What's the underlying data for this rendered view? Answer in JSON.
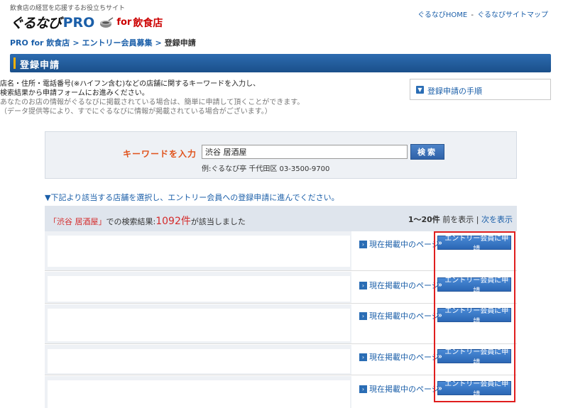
{
  "header": {
    "tagline": "飲食店の経営を応援するお役立ちサイト",
    "logo": {
      "gurunavi": "ぐるなび",
      "pro": "PRO",
      "for": "for",
      "shop": "飲食店"
    },
    "links": {
      "home": "ぐるなびHOME",
      "separator": "-",
      "sitemap": "ぐるなびサイトマップ"
    }
  },
  "breadcrumb": {
    "items": [
      "PRO for 飲食店",
      "エントリー会員募集"
    ],
    "current": "登録申請",
    "arrow": ">"
  },
  "page_title": "登録申請",
  "intro": {
    "line1": "店名・住所・電話番号(※ハイフン含む)などの店舗に関するキーワードを入力し、",
    "line2": "検索結果から申請フォームにお進みください。",
    "line3": "あなたのお店の情報がぐるなびに掲載されている場合は、簡単に申請して頂くことができます。",
    "line4": "（データ提供等により、すでにぐるなびに情報が掲載されている場合がございます。）"
  },
  "steps_link": "登録申請の手順",
  "search": {
    "label": "キーワードを入力",
    "value": "渋谷 居酒屋",
    "button": "検索",
    "example": "例:ぐるなび亭  千代田区  03-3500-9700"
  },
  "instruction": "▼下記より該当する店舗を選択し、エントリー会員への登録申請に進んでください。",
  "results": {
    "keyword_quoted": "「渋谷 居酒屋」",
    "summary_mid": "での検索結果:",
    "count": "1092件",
    "summary_end": "が該当しました",
    "range": "1〜20件",
    "prev": "前を表示",
    "divider": "|",
    "next": "次を表示"
  },
  "row_actions": {
    "view_label": "現在掲載中のページ",
    "apply_label": "エントリー会員に申請",
    "apply_prefix": "»"
  },
  "colors": {
    "accent": "#1b5fa9",
    "highlight": "#e01e1e",
    "orange": "#e0521b"
  }
}
